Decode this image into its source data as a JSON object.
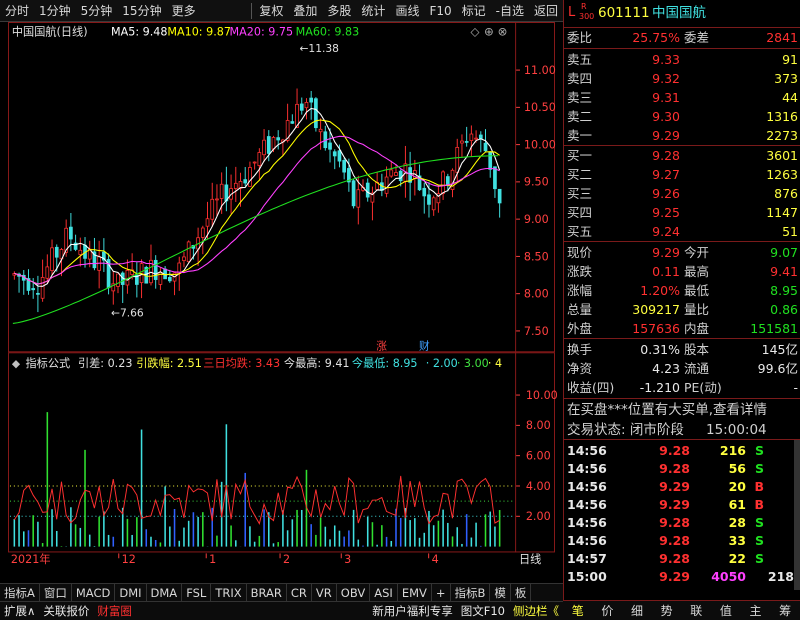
{
  "toolbar": {
    "left_items": [
      "分时",
      "1分钟",
      "5分钟",
      "15分钟",
      "更多"
    ],
    "right_items": [
      "复权",
      "叠加",
      "多股",
      "统计",
      "画线",
      "F10",
      "标记",
      "-自选",
      "返回"
    ]
  },
  "main_chart": {
    "title": "中国国航(日线)",
    "ma5": "MA5: 9.48",
    "ma10": "MA10: 9.87",
    "ma20": "MA20: 9.75",
    "ma60": "MA60: 9.83",
    "high_marker": "11.38",
    "low_marker": "7.66",
    "yticks": [
      "11.00",
      "10.50",
      "10.00",
      "9.50",
      "9.00",
      "8.50",
      "8.00",
      "7.50"
    ],
    "event_zhang": "涨",
    "event_cai": "财",
    "colors": {
      "ma5": "#ffffff",
      "ma10": "#ffff00",
      "ma20": "#ff40ff",
      "ma60": "#20e020",
      "up": "#ff3030",
      "down": "#40e0e0"
    }
  },
  "indicator": {
    "title": "指标公式",
    "yincha": "引差: 0.23",
    "yindiefu": "引跌幅: 2.51",
    "sanri": "三日均跌: 3.43",
    "jinzuigao": "今最高: 9.41",
    "jinzuidi": "今最低: 8.95",
    "v1": "2.00",
    "v2": "3.00",
    "v3": "4",
    "yticks": [
      "10.00",
      "8.00",
      "6.00",
      "4.00",
      "2.00"
    ]
  },
  "x_axis": {
    "labels": [
      "2021年",
      "12",
      "1",
      "2",
      "3",
      "4"
    ],
    "right_label": "日线"
  },
  "bottom_tabs": [
    "指标A",
    "窗口",
    "MACD",
    "DMI",
    "DMA",
    "FSL",
    "TRIX",
    "BRAR",
    "CR",
    "VR",
    "OBV",
    "ASI",
    "EMV",
    "+",
    "指标B",
    "模",
    "板"
  ],
  "status_bar": {
    "left": [
      "扩展∧",
      "关联报价",
      "财富圈"
    ],
    "right": [
      "新用户福利专享",
      "图文F10",
      "侧边栏《"
    ]
  },
  "quote": {
    "code_tag_l": "L",
    "code_tag_r": "R",
    "code_tag_n": "300",
    "code": "601111",
    "name": "中国国航",
    "weibi_label": "委比",
    "weibi": "25.75%",
    "weicha_label": "委差",
    "weicha": "2841",
    "sell": [
      {
        "label": "卖五",
        "price": "9.33",
        "vol": "91"
      },
      {
        "label": "卖四",
        "price": "9.32",
        "vol": "373"
      },
      {
        "label": "卖三",
        "price": "9.31",
        "vol": "44"
      },
      {
        "label": "卖二",
        "price": "9.30",
        "vol": "1316"
      },
      {
        "label": "卖一",
        "price": "9.29",
        "vol": "2273"
      }
    ],
    "buy": [
      {
        "label": "买一",
        "price": "9.28",
        "vol": "3601"
      },
      {
        "label": "买二",
        "price": "9.27",
        "vol": "1263"
      },
      {
        "label": "买三",
        "price": "9.26",
        "vol": "876"
      },
      {
        "label": "买四",
        "price": "9.25",
        "vol": "1147"
      },
      {
        "label": "买五",
        "price": "9.24",
        "vol": "51"
      }
    ],
    "stats": [
      {
        "l1": "现价",
        "v1": "9.29",
        "l2": "今开",
        "v2": "9.07",
        "c1": "red",
        "c2": "grn"
      },
      {
        "l1": "涨跌",
        "v1": "0.11",
        "l2": "最高",
        "v2": "9.41",
        "c1": "red",
        "c2": "red"
      },
      {
        "l1": "涨幅",
        "v1": "1.20%",
        "l2": "最低",
        "v2": "8.95",
        "c1": "red",
        "c2": "grn"
      },
      {
        "l1": "总量",
        "v1": "309217",
        "l2": "量比",
        "v2": "0.86",
        "c1": "yel",
        "c2": "grn"
      },
      {
        "l1": "外盘",
        "v1": "157636",
        "l2": "内盘",
        "v2": "151581",
        "c1": "red",
        "c2": "grn"
      }
    ],
    "stats2": [
      {
        "l1": "换手",
        "v1": "0.31%",
        "l2": "股本",
        "v2": "145亿"
      },
      {
        "l1": "净资",
        "v1": "4.23",
        "l2": "流通",
        "v2": "99.6亿"
      },
      {
        "l1": "收益(四)",
        "v1": "-1.210",
        "l2": "PE(动)",
        "v2": "-"
      }
    ],
    "notice1": "在买盘***位置有大买单,查看详情",
    "notice2_label": "交易状态: 闭市阶段",
    "notice2_time": "15:00:04",
    "ticks": [
      {
        "t": "14:56",
        "p": "9.28",
        "v": "216",
        "s": "S"
      },
      {
        "t": "14:56",
        "p": "9.28",
        "v": "56",
        "s": "S"
      },
      {
        "t": "14:56",
        "p": "9.29",
        "v": "20",
        "s": "B"
      },
      {
        "t": "14:56",
        "p": "9.29",
        "v": "61",
        "s": "B"
      },
      {
        "t": "14:56",
        "p": "9.28",
        "v": "28",
        "s": "S"
      },
      {
        "t": "14:56",
        "p": "9.28",
        "v": "33",
        "s": "S"
      },
      {
        "t": "14:57",
        "p": "9.28",
        "v": "22",
        "s": "S"
      },
      {
        "t": "15:00",
        "p": "9.29",
        "v": "4050",
        "s": "218"
      }
    ],
    "tabs": [
      "笔",
      "价",
      "细",
      "势",
      "联",
      "值",
      "主",
      "筹"
    ]
  }
}
